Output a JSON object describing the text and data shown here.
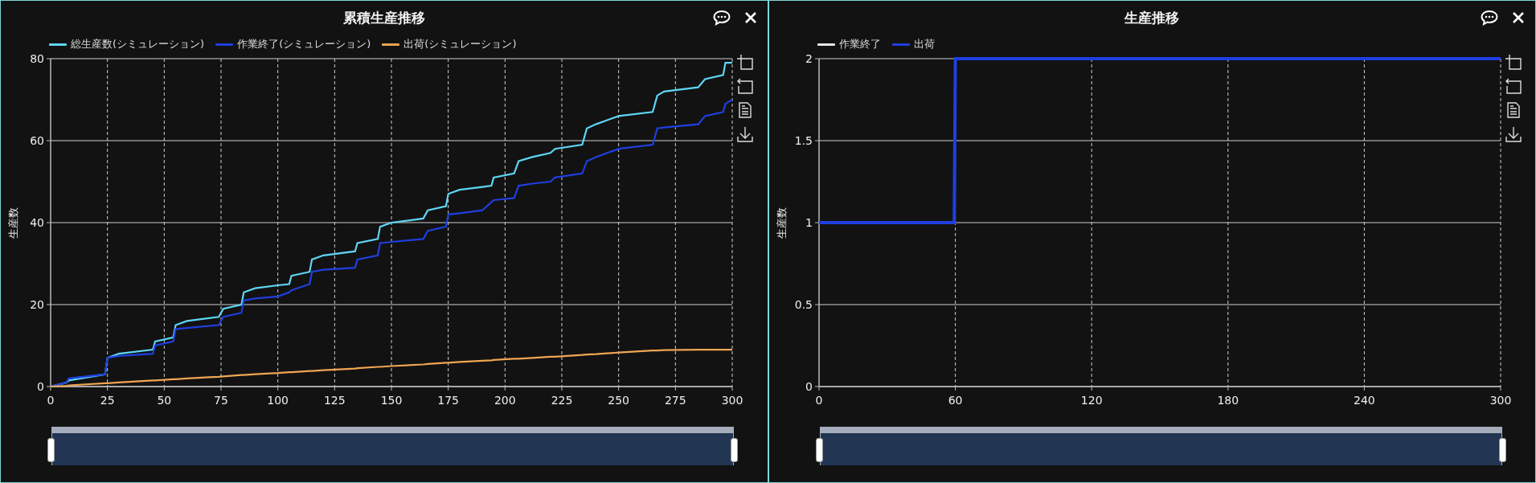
{
  "panels": [
    {
      "chart_data": {
        "type": "line",
        "title": "累積生産推移",
        "ylabel": "生産数",
        "x": [
          0,
          7,
          8,
          24,
          25,
          30,
          45,
          46,
          54,
          55,
          60,
          74,
          76,
          84,
          85,
          90,
          100,
          105,
          106,
          114,
          115,
          120,
          134,
          135,
          144,
          145,
          150,
          164,
          166,
          174,
          175,
          180,
          190,
          194,
          195,
          204,
          206,
          212,
          220,
          222,
          234,
          236,
          240,
          245,
          250,
          265,
          267,
          270,
          285,
          288,
          296,
          297,
          300
        ],
        "series": [
          {
            "name": "総生産数(シミュレーション)",
            "color": "#5ed6f5",
            "values": [
              0,
              1,
              1.5,
              3,
              7,
              8,
              9,
              11,
              12,
              15,
              16,
              17,
              19,
              20,
              23,
              24,
              24.7,
              25,
              27,
              28,
              31,
              32,
              33,
              35,
              36,
              39,
              40,
              41,
              43,
              44,
              47,
              48,
              48.7,
              49,
              51,
              52,
              55,
              56,
              57,
              58,
              59,
              63,
              64,
              65,
              66,
              67,
              71,
              72,
              73,
              75,
              76,
              79,
              79
            ]
          },
          {
            "name": "作業終了(シミュレーション)",
            "color": "#1f3fe0",
            "values": [
              0,
              1,
              2,
              3,
              7,
              7.5,
              8,
              10,
              11,
              14,
              14.3,
              15,
              17,
              18,
              21,
              21.5,
              22,
              23,
              23.5,
              25,
              28,
              28.5,
              29,
              31,
              32,
              35,
              35.3,
              36,
              38,
              39,
              42,
              42.3,
              43,
              45,
              45.5,
              46,
              49,
              49.5,
              50,
              51,
              52,
              55,
              56,
              57,
              58,
              59,
              63,
              63.2,
              64,
              66,
              67,
              69,
              70
            ]
          },
          {
            "name": "出荷(シミュレーション)",
            "color": "#f0a552",
            "values": [
              0,
              0.2,
              0.3,
              0.8,
              0.8,
              1,
              1.5,
              1.5,
              1.8,
              1.8,
              2,
              2.4,
              2.5,
              2.8,
              2.8,
              3,
              3.3,
              3.5,
              3.5,
              3.8,
              3.8,
              4,
              4.4,
              4.5,
              4.8,
              4.8,
              5,
              5.4,
              5.5,
              5.8,
              5.8,
              6,
              6.3,
              6.4,
              6.5,
              6.8,
              6.8,
              7,
              7.3,
              7.3,
              7.7,
              7.8,
              7.9,
              8.1,
              8.3,
              8.8,
              8.8,
              8.9,
              9,
              9,
              9,
              9,
              9
            ]
          }
        ],
        "xlim": [
          0,
          300
        ],
        "ylim": [
          0,
          80
        ],
        "xticks": [
          0,
          25,
          50,
          75,
          100,
          125,
          150,
          175,
          200,
          225,
          250,
          275,
          300
        ],
        "yticks": [
          0,
          20,
          40,
          60,
          80
        ],
        "grid": true
      },
      "range_slider": {
        "level": 1
      }
    },
    {
      "chart_data": {
        "type": "line",
        "title": "生産推移",
        "ylabel": "生産数",
        "x": [
          0,
          59.5,
          60,
          300
        ],
        "series": [
          {
            "name": "作業終了",
            "color": "#e6e6e6",
            "values": [
              null,
              null,
              null,
              null
            ]
          },
          {
            "name": "出荷",
            "color": "#1f3fe0",
            "values": [
              1,
              1,
              2,
              2
            ]
          }
        ],
        "xlim": [
          0,
          300
        ],
        "ylim": [
          0,
          2
        ],
        "xticks": [
          0,
          60,
          120,
          180,
          240,
          300
        ],
        "yticks": [
          0,
          0.5,
          1,
          1.5,
          2
        ],
        "grid": true
      },
      "range_slider": {
        "level": 1
      }
    }
  ]
}
